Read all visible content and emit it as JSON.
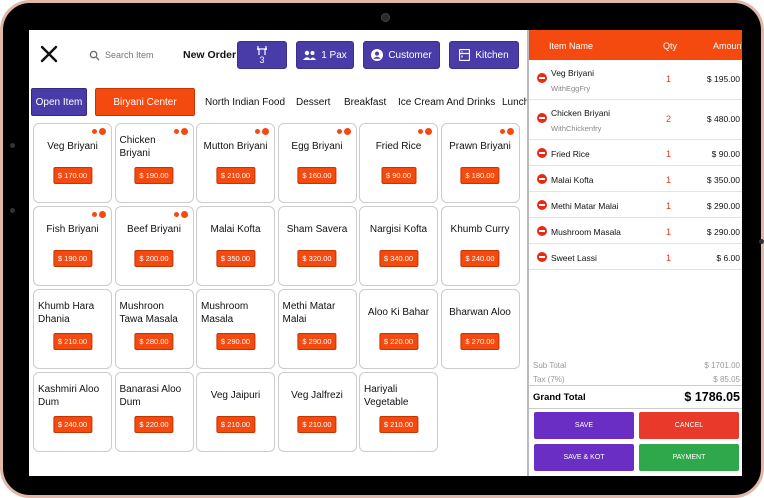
{
  "header": {
    "search_placeholder": "Search Item",
    "new_order": "New Order",
    "table_number": "3",
    "pax_label": "1 Pax",
    "customer_label": "Customer",
    "kitchen_label": "Kitchen"
  },
  "categories": {
    "open_item": "Open Item",
    "active": "Biryani Center",
    "others": [
      "North Indian Food",
      "Dessert",
      "Breakfast",
      "Ice Cream And Drinks",
      "Lunch"
    ]
  },
  "items": [
    {
      "name": "Veg Briyani",
      "price": "$ 170.00",
      "dots": true
    },
    {
      "name": "Chicken Briyani",
      "price": "$ 190.00",
      "dots": true
    },
    {
      "name": "Mutton Briyani",
      "price": "$ 210.00",
      "dots": true
    },
    {
      "name": "Egg Briyani",
      "price": "$ 160.00",
      "dots": true
    },
    {
      "name": "Fried Rice",
      "price": "$ 90.00",
      "dots": true
    },
    {
      "name": "Prawn Briyani",
      "price": "$ 180.00",
      "dots": true
    },
    {
      "name": "Fish Briyani",
      "price": "$ 190.00",
      "dots": true
    },
    {
      "name": "Beef Briyani",
      "price": "$ 200.00",
      "dots": true
    },
    {
      "name": "Malai Kofta",
      "price": "$ 350.00",
      "dots": false
    },
    {
      "name": "Sham Savera",
      "price": "$ 320.00",
      "dots": false
    },
    {
      "name": "Nargisi Kofta",
      "price": "$ 340.00",
      "dots": false
    },
    {
      "name": "Khumb Curry",
      "price": "$ 240.00",
      "dots": false
    },
    {
      "name": "Khumb Hara Dhania",
      "price": "$ 210.00",
      "dots": false
    },
    {
      "name": "Mushroon Tawa Masala",
      "price": "$ 280.00",
      "dots": false
    },
    {
      "name": "Mushroom Masala",
      "price": "$ 290.00",
      "dots": false
    },
    {
      "name": "Methi Matar Malai",
      "price": "$ 290.00",
      "dots": false
    },
    {
      "name": "Aloo Ki Bahar",
      "price": "$ 220.00",
      "dots": false
    },
    {
      "name": "Bharwan Aloo",
      "price": "$ 270.00",
      "dots": false
    },
    {
      "name": "Kashmiri Aloo Dum",
      "price": "$ 240.00",
      "dots": false
    },
    {
      "name": "Banarasi Aloo Dum",
      "price": "$ 220.00",
      "dots": false
    },
    {
      "name": "Veg Jaipuri",
      "price": "$ 210.00",
      "dots": false
    },
    {
      "name": "Veg Jalfrezi",
      "price": "$ 210.00",
      "dots": false
    },
    {
      "name": "Hariyali Vegetable",
      "price": "$ 210.00",
      "dots": false
    }
  ],
  "order": {
    "col_item": "Item Name",
    "col_qty": "Qty",
    "col_amount": "Amount",
    "lines": [
      {
        "name": "Veg Briyani",
        "sub": "WithEggFry",
        "qty": "1",
        "amount": "$ 195.00"
      },
      {
        "name": "Chicken Briyani",
        "sub": "WithChickenfry",
        "qty": "2",
        "amount": "$ 480.00"
      },
      {
        "name": "Fried Rice",
        "sub": "",
        "qty": "1",
        "amount": "$ 90.00"
      },
      {
        "name": "Malai Kofta",
        "sub": "",
        "qty": "1",
        "amount": "$ 350.00"
      },
      {
        "name": "Methi Matar Malai",
        "sub": "",
        "qty": "1",
        "amount": "$ 290.00"
      },
      {
        "name": "Mushroom Masala",
        "sub": "",
        "qty": "1",
        "amount": "$ 290.00"
      },
      {
        "name": "Sweet Lassi",
        "sub": "",
        "qty": "1",
        "amount": "$ 6.00"
      }
    ],
    "subtotal_label": "Sub Total",
    "subtotal": "$ 1701.00",
    "tax_label": "Tax (7%)",
    "tax": "$ 85.05",
    "grand_label": "Grand Total",
    "grand": "$ 1786.05"
  },
  "actions": {
    "save": "SAVE",
    "cancel": "CANCEL",
    "save_kot": "SAVE & KOT",
    "payment": "PAYMENT"
  },
  "colors": {
    "accent": "#f54a0f",
    "primary": "#4a3ca8",
    "cancel": "#e8392a",
    "payment": "#2ea84a",
    "save": "#6a2ec4"
  }
}
